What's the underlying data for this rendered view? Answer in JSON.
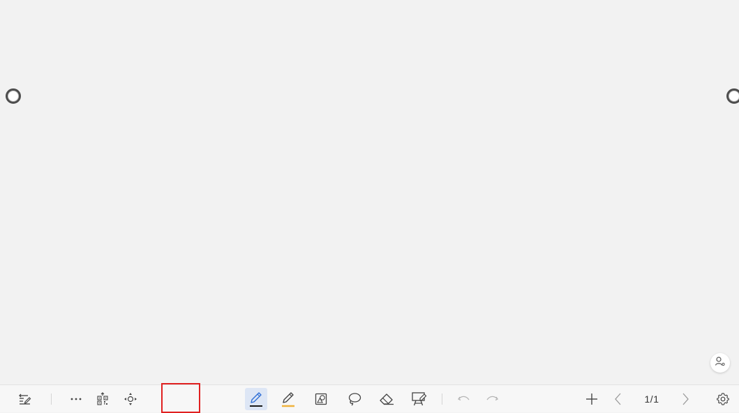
{
  "canvas": {
    "background": "#f2f2f2"
  },
  "toolbar": {
    "left": [
      {
        "name": "notes-list-icon"
      },
      {
        "name": "more-dots-icon"
      },
      {
        "name": "qr-share-icon"
      },
      {
        "name": "move-toolbar-icon"
      }
    ],
    "center": [
      {
        "name": "pen-icon",
        "active": true,
        "underline_color": "#1a1a1a"
      },
      {
        "name": "highlighter-icon",
        "underline_color": "#f0b23c"
      },
      {
        "name": "shape-recognition-icon"
      },
      {
        "name": "lasso-icon"
      },
      {
        "name": "eraser-icon"
      },
      {
        "name": "whiteboard-stand-icon"
      },
      {
        "name": "undo-icon"
      },
      {
        "name": "redo-icon"
      }
    ],
    "right": [
      {
        "name": "add-page-icon"
      },
      {
        "name": "prev-page-icon"
      },
      {
        "name": "next-page-icon"
      },
      {
        "name": "settings-gear-icon"
      }
    ],
    "page_indicator": "1/1",
    "highlight_box_color": "#e02020",
    "accent_color": "#2f6fd6"
  }
}
